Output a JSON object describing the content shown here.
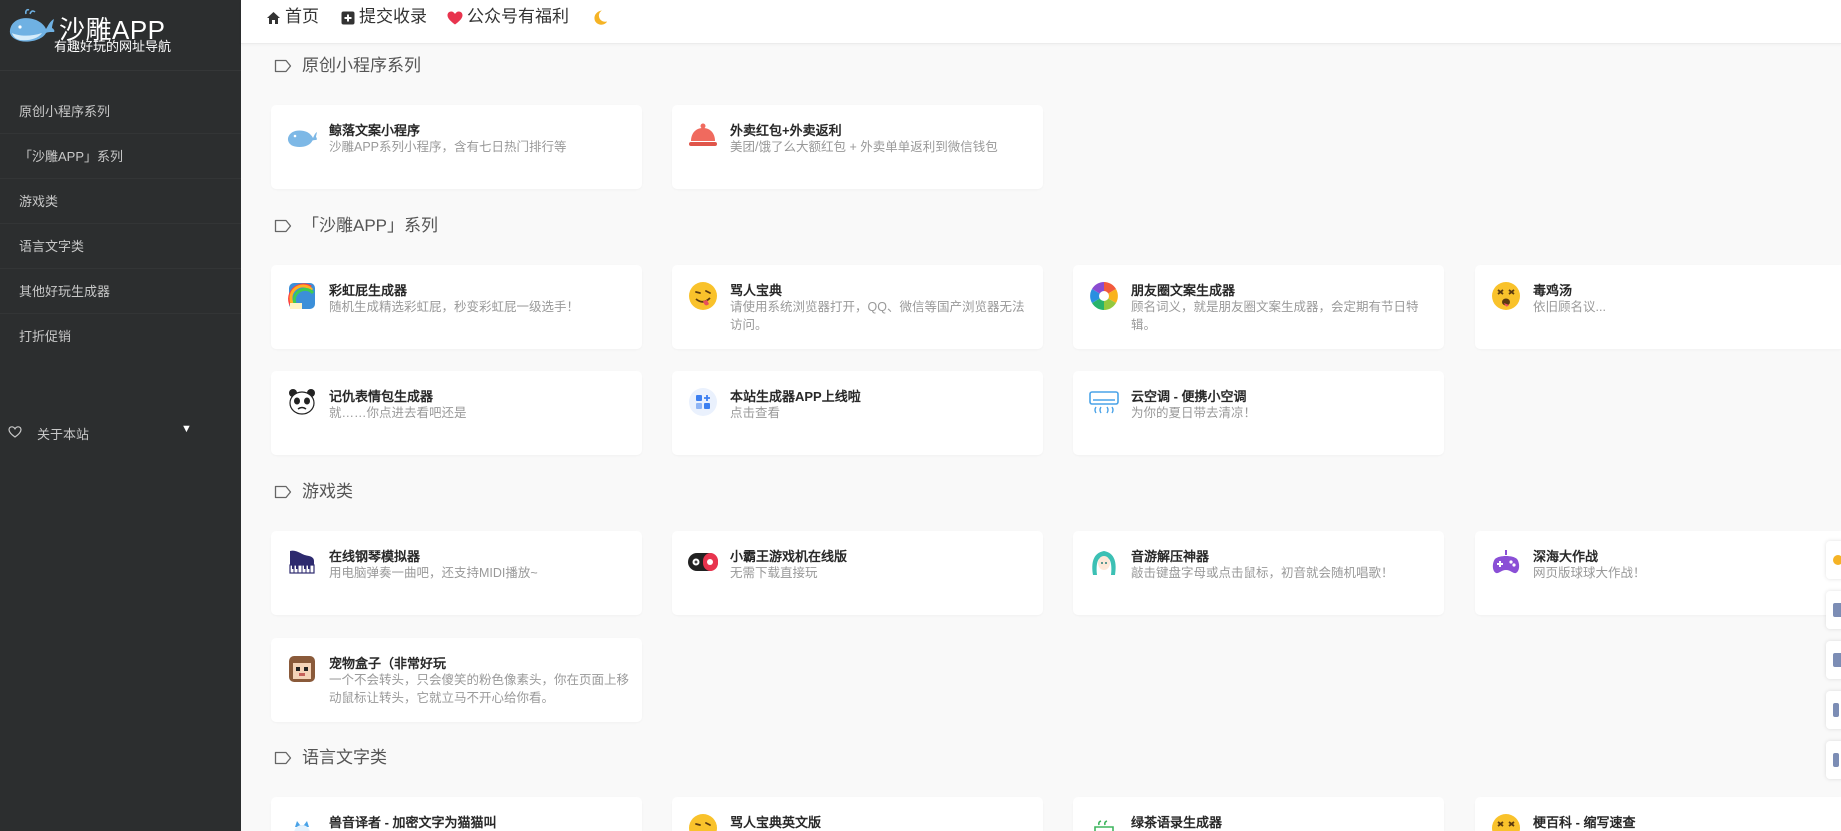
{
  "brand": {
    "title": "沙雕APP",
    "subtitle": "有趣好玩的网址导航"
  },
  "sidebar": {
    "items": [
      {
        "label": "原创小程序系列"
      },
      {
        "label": "「沙雕APP」系列"
      },
      {
        "label": "游戏类"
      },
      {
        "label": "语言文字类"
      },
      {
        "label": "其他好玩生成器"
      },
      {
        "label": "打折促销"
      }
    ],
    "about": {
      "label": "关于本站",
      "caret": "▼"
    }
  },
  "topbar": {
    "home": "首页",
    "submit": "提交收录",
    "wechat": "公众号有福利"
  },
  "sections": [
    {
      "title": "原创小程序系列",
      "cards": [
        {
          "title": "鲸落文案小程序",
          "desc": "沙雕APP系列小程序，含有七日热门排行等",
          "icon": "whale-icon"
        },
        {
          "title": "外卖红包+外卖返利",
          "desc": "美团/饿了么大额红包 + 外卖单单返利到微信钱包",
          "icon": "food-cover-icon"
        }
      ]
    },
    {
      "title": "「沙雕APP」系列",
      "cards": [
        {
          "title": "彩虹屁生成器",
          "desc": "随机生成精选彩虹屁，秒变彩虹屁一级选手！",
          "icon": "rainbow-icon"
        },
        {
          "title": "骂人宝典",
          "desc": "请使用系统浏览器打开，QQ、微信等国产浏览器无法访问。",
          "icon": "tongue-emoji-icon"
        },
        {
          "title": "朋友圈文案生成器",
          "desc": "顾名词义，就是朋友圈文案生成器，会定期有节日特辑。",
          "icon": "aperture-icon"
        },
        {
          "title": "毒鸡汤",
          "desc": "依旧顾名议...",
          "icon": "dizzy-emoji-icon"
        },
        {
          "title": "记仇表情包生成器",
          "desc": "就……你点进去看吧还是",
          "icon": "panda-icon"
        },
        {
          "title": "本站生成器APP上线啦",
          "desc": "点击查看",
          "icon": "app-grid-icon"
        },
        {
          "title": "云空调 - 便携小空调",
          "desc": "为你的夏日带去清凉！",
          "icon": "air-conditioner-icon"
        }
      ]
    },
    {
      "title": "游戏类",
      "cards": [
        {
          "title": "在线钢琴模拟器",
          "desc": "用电脑弹奏一曲吧，还支持MIDI播放~",
          "icon": "piano-icon"
        },
        {
          "title": "小霸王游戏机在线版",
          "desc": "无需下载直接玩",
          "icon": "game-console-icon"
        },
        {
          "title": "音游解压神器",
          "desc": "敲击键盘字母或点击鼠标，初音就会随机唱歌！",
          "icon": "miku-icon"
        },
        {
          "title": "深海大作战",
          "desc": "网页版球球大作战！",
          "icon": "gamepad-icon"
        },
        {
          "title": "宠物盒子（非常好玩",
          "desc": "一个不会转头，只会傻笑的粉色像素头，你在页面上移动鼠标让转头，它就立马不开心给你看。",
          "icon": "pixel-pet-icon"
        }
      ]
    },
    {
      "title": "语言文字类",
      "cards": [
        {
          "title": "兽音译者 - 加密文字为猫猫叫",
          "icon": "cat-icon"
        },
        {
          "title": "骂人宝典英文版",
          "icon": "tongue-emoji-icon"
        },
        {
          "title": "绿茶语录生成器",
          "icon": "tea-icon"
        },
        {
          "title": "梗百科 - 缩写速查",
          "icon": "dizzy-emoji-icon"
        }
      ]
    }
  ],
  "colors": {
    "sidebar_bg": "#2c2e2f",
    "page_bg": "#f9f9f9",
    "heart": "#e8344e",
    "moon": "#f5b325"
  }
}
